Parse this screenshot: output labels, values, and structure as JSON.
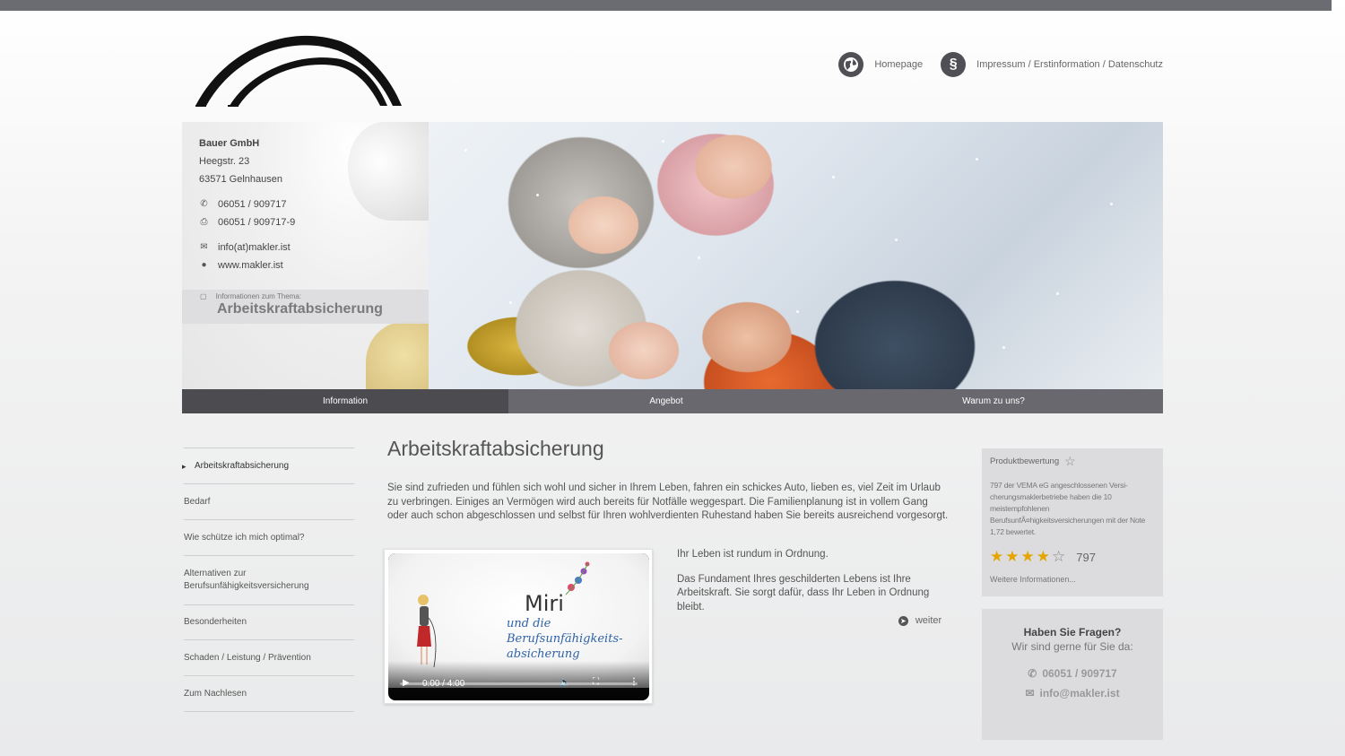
{
  "header": {
    "nav": [
      {
        "icon": "globe-icon",
        "label": "Homepage"
      },
      {
        "icon": "paragraph-icon",
        "glyph": "§",
        "label": "Impressum / Erstinformation / Datenschutz"
      }
    ]
  },
  "contact": {
    "company": "Bauer GmbH",
    "street": "Heegstr. 23",
    "city": "63571 Gelnhausen",
    "phone": "06051 / 909717",
    "fax": "06051 / 909717-9",
    "email": "info(at)makler.ist",
    "web": "www.makler.ist"
  },
  "topic": {
    "small_label": "Informationen zum Thema:",
    "title": "Arbeitskraftabsicherung"
  },
  "tabs": [
    {
      "label": "Information",
      "active": true
    },
    {
      "label": "Angebot",
      "active": false
    },
    {
      "label": "Warum zu uns?",
      "active": false
    }
  ],
  "sidemenu": [
    "Arbeitskraftabsicherung",
    "Bedarf",
    "Wie schütze ich mich optimal?",
    "Alternativen zur Berufsunfähigkeitsversicherung",
    "Besonderheiten",
    "Schaden / Leistung / Prävention",
    "Zum Nachlesen"
  ],
  "main": {
    "title": "Arbeitskraftabsicherung",
    "lead": "Sie sind zufrieden und fühlen sich wohl und sicher in Ihrem Leben, fahren ein schickes Auto, lieben es, viel Zeit im Urlaub zu verbringen. Einiges an Vermögen wird auch bereits für Notfälle weggespart. Die Familienplanung ist in vollem Gang oder auch schon abgeschlossen und selbst für Ihren wohlverdienten Ruhestand haben Sie bereits ausreichend vorgesorgt.",
    "para1": "Ihr Leben ist rundum in Ordnung.",
    "para2": "Das Fundament Ihres geschilderten Lebens ist Ihre Arbeitskraft. Sie sorgt dafür, dass Ihr Leben in Ordnung bleibt.",
    "weiter": "weiter",
    "video": {
      "title_main": "Miri",
      "title_sub1": "und die",
      "title_sub2": "Berufsunfähigkeits-",
      "title_sub3": "absicherung",
      "time": "0:00 / 4:00",
      "progress": 0
    }
  },
  "rating": {
    "header": "Produktbewertung",
    "description": "797 der VEMA eG angeschlossenen Versi- cherungsmaklerbetriebe haben die 10 meistempfohlenen BerufsunfÃ¤higkeitsversicherungen mit der Note 1,72 bewertet.",
    "stars_filled": 4,
    "stars_total": 5,
    "count": "797",
    "more": "Weitere Informationen..."
  },
  "questions": {
    "title": "Haben Sie Fragen?",
    "subtitle": "Wir sind gerne für Sie da:",
    "phone": "06051 / 909717",
    "email": "info@makler.ist"
  },
  "colors": {
    "tab_active": "#4b4b50",
    "tab_inactive": "#68686e",
    "star": "#e4a500",
    "topbar": "#6b6b72"
  }
}
